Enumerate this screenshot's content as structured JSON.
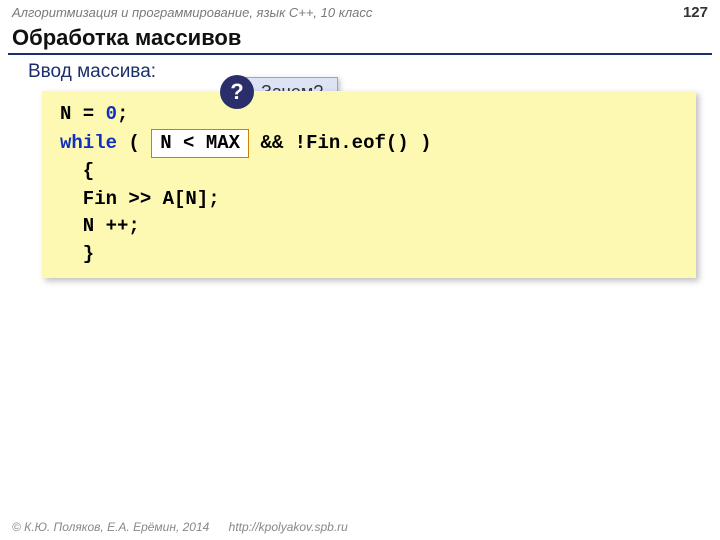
{
  "header": {
    "breadcrumb": "Алгоритмизация и программирование, язык C++, 10 класс",
    "page_number": "127"
  },
  "title": "Обработка массивов",
  "subtitle": "Ввод массива:",
  "callout": {
    "q_mark": "?",
    "label": "Зачем?"
  },
  "code": {
    "l1_a": "N",
    "l1_eq": " = ",
    "l1_zero": "0",
    "l1_semi": ";",
    "l2_while": "while",
    "l2_open": " ( ",
    "l2_cond_box": "N < MAX",
    "l2_rest": "  &&  !Fin.eof() )",
    "l3": "  {",
    "l4": "  Fin >> A[N];",
    "l5": "  N ++;",
    "l6": "  }"
  },
  "footer": {
    "copyright": "© К.Ю. Поляков, Е.А. Ерёмин, 2014",
    "url": "http://kpolyakov.spb.ru"
  }
}
